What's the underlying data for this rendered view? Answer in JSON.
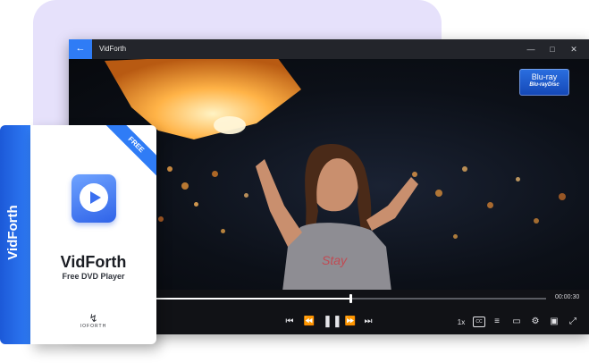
{
  "window": {
    "title": "VidForth",
    "back_icon": "arrow-left-icon",
    "minimize_icon": "minimize-icon",
    "maximize_icon": "maximize-icon",
    "close_icon": "close-icon"
  },
  "video": {
    "badge_top": "Blu-ray",
    "badge_bottom": "Blu-rayDisc",
    "badge_icon": "blu-ray-disc-icon"
  },
  "playback": {
    "progress": 0.5,
    "time": "00:00:30",
    "speed": "1x",
    "cc": "CC",
    "controls": [
      {
        "name": "previous-icon"
      },
      {
        "name": "rewind-icon"
      },
      {
        "name": "pause-icon"
      },
      {
        "name": "fast-forward-icon"
      },
      {
        "name": "next-icon"
      }
    ],
    "right_icons": [
      "playlist-icon",
      "screen-cast-icon",
      "settings-icon",
      "mini-player-icon",
      "fullscreen-icon"
    ]
  },
  "product_box": {
    "side_text": "VidForth",
    "ribbon": "FREE",
    "brand": "VidForth",
    "product": "Free DVD Player",
    "maker": "IOFORTH",
    "logo_icon": "play-button-icon",
    "maker_icon": "lightning-bolt-icon"
  },
  "colors": {
    "accent": "#2f7cf6",
    "backdrop": "#e6e1fb",
    "player_bg": "#15161a"
  }
}
